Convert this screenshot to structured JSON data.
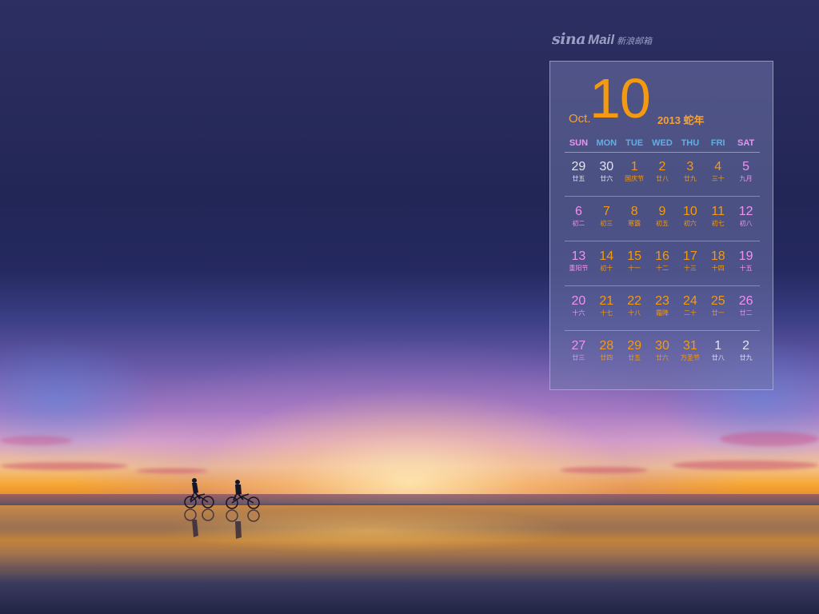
{
  "logo": {
    "brand": "sina",
    "product": "Mail",
    "chinese": "新浪邮箱"
  },
  "calendar": {
    "month_abbr": "Oct.",
    "month_number": "10",
    "year_label": "2013 蛇年",
    "colors": {
      "accent_orange": "#f39a10",
      "weekend_pink": "#ee92f2",
      "weekday_blue": "#5fb0e6",
      "muted_gray": "#e4e4f0"
    },
    "weekdays": [
      {
        "label": "SUN",
        "kind": "weekend"
      },
      {
        "label": "MON",
        "kind": "weekday"
      },
      {
        "label": "TUE",
        "kind": "weekday"
      },
      {
        "label": "WED",
        "kind": "weekday"
      },
      {
        "label": "THU",
        "kind": "weekday"
      },
      {
        "label": "FRI",
        "kind": "weekday"
      },
      {
        "label": "SAT",
        "kind": "weekend"
      }
    ],
    "weeks": [
      [
        {
          "day": "29",
          "lunar": "廿五",
          "kind": "other"
        },
        {
          "day": "30",
          "lunar": "廿六",
          "kind": "other"
        },
        {
          "day": "1",
          "lunar": "国庆节",
          "kind": "weekday"
        },
        {
          "day": "2",
          "lunar": "廿八",
          "kind": "weekday"
        },
        {
          "day": "3",
          "lunar": "廿九",
          "kind": "weekday"
        },
        {
          "day": "4",
          "lunar": "三十",
          "kind": "weekday"
        },
        {
          "day": "5",
          "lunar": "九月",
          "kind": "weekend"
        }
      ],
      [
        {
          "day": "6",
          "lunar": "初二",
          "kind": "weekend"
        },
        {
          "day": "7",
          "lunar": "初三",
          "kind": "weekday"
        },
        {
          "day": "8",
          "lunar": "寒露",
          "kind": "weekday"
        },
        {
          "day": "9",
          "lunar": "初五",
          "kind": "weekday"
        },
        {
          "day": "10",
          "lunar": "初六",
          "kind": "weekday"
        },
        {
          "day": "11",
          "lunar": "初七",
          "kind": "weekday"
        },
        {
          "day": "12",
          "lunar": "初八",
          "kind": "weekend"
        }
      ],
      [
        {
          "day": "13",
          "lunar": "重阳节",
          "kind": "weekend"
        },
        {
          "day": "14",
          "lunar": "初十",
          "kind": "weekday"
        },
        {
          "day": "15",
          "lunar": "十一",
          "kind": "weekday"
        },
        {
          "day": "16",
          "lunar": "十二",
          "kind": "weekday"
        },
        {
          "day": "17",
          "lunar": "十三",
          "kind": "weekday"
        },
        {
          "day": "18",
          "lunar": "十四",
          "kind": "weekday"
        },
        {
          "day": "19",
          "lunar": "十五",
          "kind": "weekend"
        }
      ],
      [
        {
          "day": "20",
          "lunar": "十六",
          "kind": "weekend"
        },
        {
          "day": "21",
          "lunar": "十七",
          "kind": "weekday"
        },
        {
          "day": "22",
          "lunar": "十八",
          "kind": "weekday"
        },
        {
          "day": "23",
          "lunar": "霜降",
          "kind": "weekday"
        },
        {
          "day": "24",
          "lunar": "二十",
          "kind": "weekday"
        },
        {
          "day": "25",
          "lunar": "廿一",
          "kind": "weekday"
        },
        {
          "day": "26",
          "lunar": "廿二",
          "kind": "weekend"
        }
      ],
      [
        {
          "day": "27",
          "lunar": "廿三",
          "kind": "weekend"
        },
        {
          "day": "28",
          "lunar": "廿四",
          "kind": "weekday"
        },
        {
          "day": "29",
          "lunar": "廿五",
          "kind": "weekday"
        },
        {
          "day": "30",
          "lunar": "廿六",
          "kind": "weekday"
        },
        {
          "day": "31",
          "lunar": "万圣节",
          "kind": "weekday"
        },
        {
          "day": "1",
          "lunar": "廿八",
          "kind": "other"
        },
        {
          "day": "2",
          "lunar": "廿九",
          "kind": "other"
        }
      ]
    ]
  },
  "scene": {
    "subject": "cyclists-silhouette"
  }
}
